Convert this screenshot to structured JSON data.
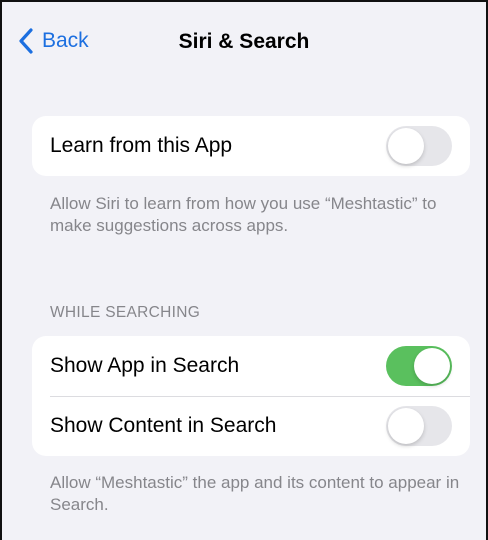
{
  "nav": {
    "back_label": "Back",
    "title": "Siri & Search"
  },
  "learn_group": {
    "label": "Learn from this App",
    "toggle_on": false
  },
  "learn_footnote": "Allow Siri to learn from how you use “Meshtastic” to make suggestions across apps.",
  "search_section": {
    "header": "WHILE SEARCHING",
    "rows": [
      {
        "label": "Show App in Search",
        "toggle_on": true
      },
      {
        "label": "Show Content in Search",
        "toggle_on": false
      }
    ],
    "footnote": "Allow “Meshtastic” the app and its content to appear in Search."
  },
  "colors": {
    "accent": "#1c6fe0",
    "toggle_on": "#5ac05e",
    "toggle_off": "#e6e6ea",
    "background": "#f2f2f7",
    "secondary_text": "#86868b"
  },
  "icons": {
    "back": "chevron-left-icon"
  }
}
